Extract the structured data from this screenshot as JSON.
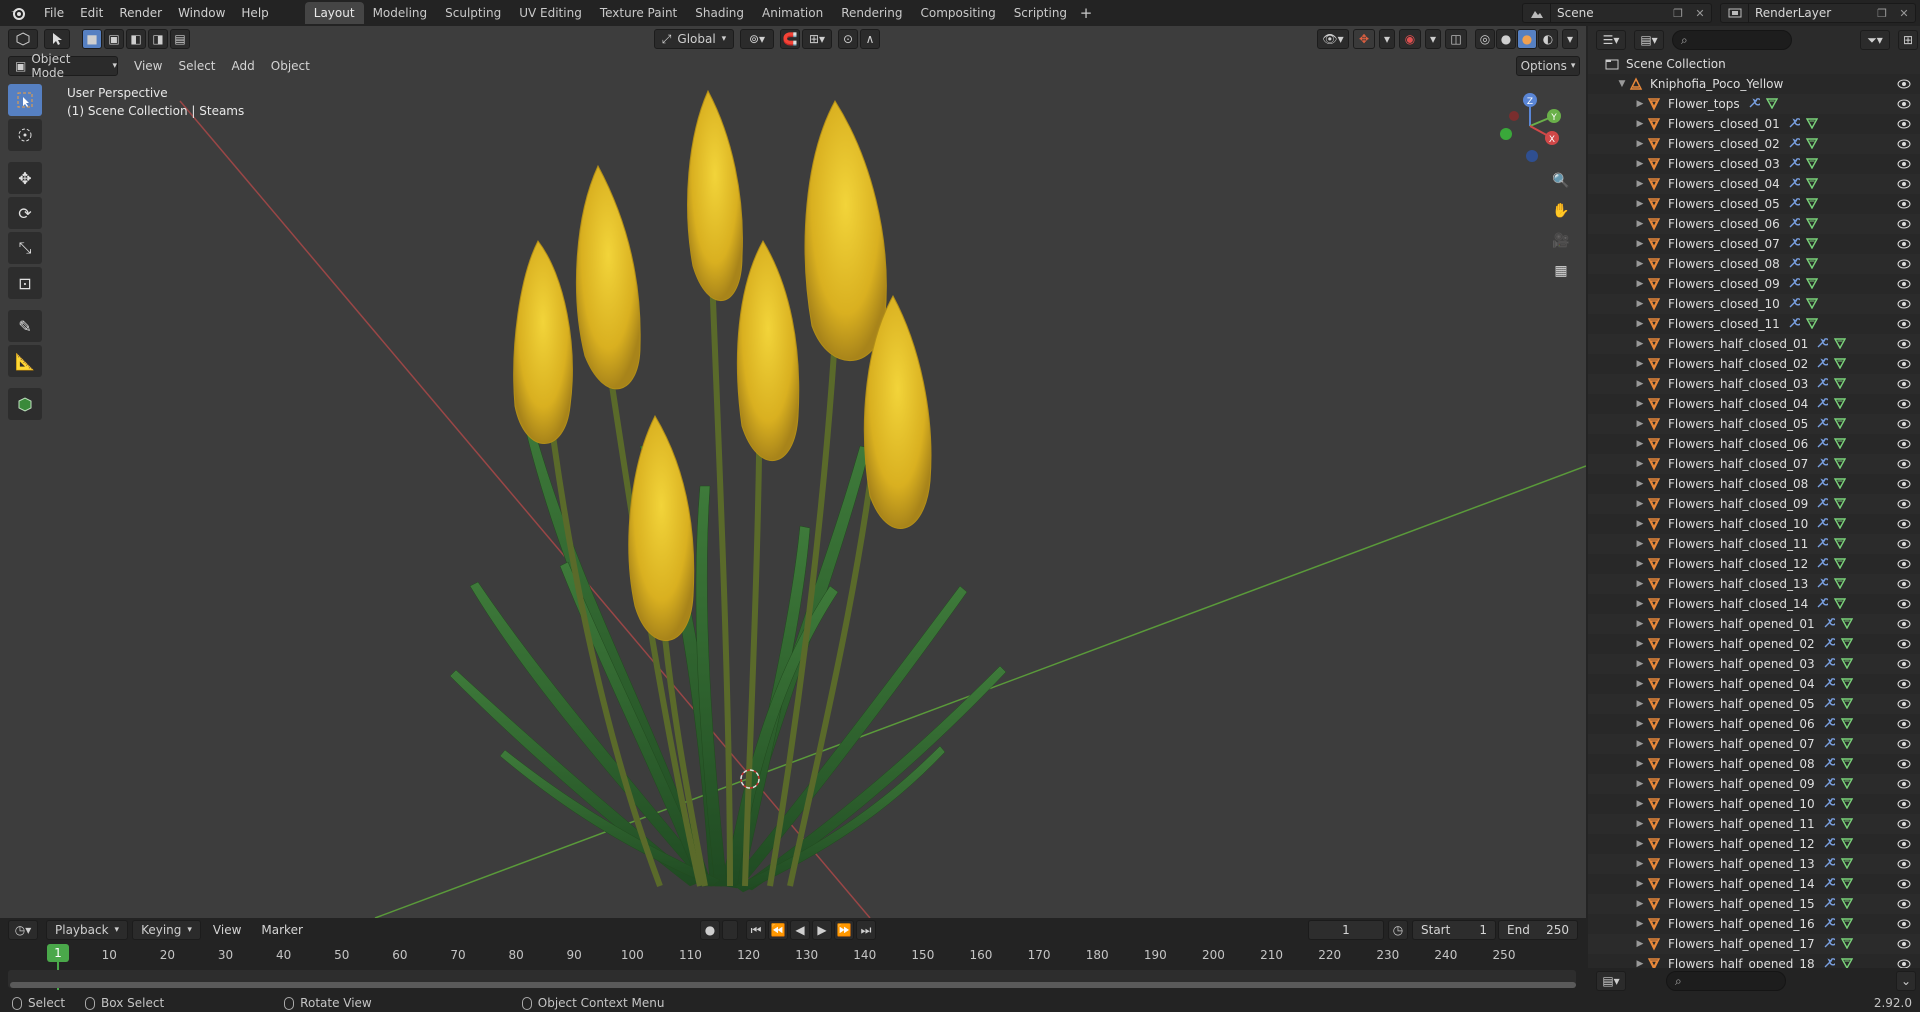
{
  "topbar": {
    "menus": [
      "File",
      "Edit",
      "Render",
      "Window",
      "Help"
    ],
    "workspaces": [
      "Layout",
      "Modeling",
      "Sculpting",
      "UV Editing",
      "Texture Paint",
      "Shading",
      "Animation",
      "Rendering",
      "Compositing",
      "Scripting"
    ],
    "active_workspace": "Layout",
    "add_tab": "+",
    "scene": "Scene",
    "view_layer": "RenderLayer"
  },
  "viewport": {
    "mode": "Object Mode",
    "menus": [
      "View",
      "Select",
      "Add",
      "Object"
    ],
    "transform_orientation": "Global",
    "options_label": "Options",
    "info_line1": "User Perspective",
    "info_line2": "(1) Scene Collection | Steams",
    "gizmo_axes": [
      "Z",
      "Y",
      "X"
    ]
  },
  "timeline": {
    "menus": [
      "Playback",
      "Keying",
      "View",
      "Marker"
    ],
    "current_frame": "1",
    "start_label": "Start",
    "start_value": "1",
    "end_label": "End",
    "end_value": "250",
    "ruler_ticks": [
      "10",
      "20",
      "30",
      "40",
      "50",
      "60",
      "70",
      "80",
      "90",
      "100",
      "110",
      "120",
      "130",
      "140",
      "150",
      "160",
      "170",
      "180",
      "190",
      "200",
      "210",
      "220",
      "230",
      "240",
      "250"
    ],
    "frame_marker": "1"
  },
  "statusbar": {
    "select": "Select",
    "box_select": "Box Select",
    "rotate_view": "Rotate View",
    "context_menu": "Object Context Menu",
    "version": "2.92.0"
  },
  "outliner": {
    "scene_collection": "Scene Collection",
    "root_object": "Kniphofia_Poco_Yellow",
    "items": [
      "Flower_tops",
      "Flowers_closed_01",
      "Flowers_closed_02",
      "Flowers_closed_03",
      "Flowers_closed_04",
      "Flowers_closed_05",
      "Flowers_closed_06",
      "Flowers_closed_07",
      "Flowers_closed_08",
      "Flowers_closed_09",
      "Flowers_closed_10",
      "Flowers_closed_11",
      "Flowers_half_closed_01",
      "Flowers_half_closed_02",
      "Flowers_half_closed_03",
      "Flowers_half_closed_04",
      "Flowers_half_closed_05",
      "Flowers_half_closed_06",
      "Flowers_half_closed_07",
      "Flowers_half_closed_08",
      "Flowers_half_closed_09",
      "Flowers_half_closed_10",
      "Flowers_half_closed_11",
      "Flowers_half_closed_12",
      "Flowers_half_closed_13",
      "Flowers_half_closed_14",
      "Flowers_half_opened_01",
      "Flowers_half_opened_02",
      "Flowers_half_opened_03",
      "Flowers_half_opened_04",
      "Flowers_half_opened_05",
      "Flowers_half_opened_06",
      "Flowers_half_opened_07",
      "Flowers_half_opened_08",
      "Flowers_half_opened_09",
      "Flowers_half_opened_10",
      "Flowers_half_opened_11",
      "Flowers_half_opened_12",
      "Flowers_half_opened_13",
      "Flowers_half_opened_14",
      "Flowers_half_opened_15",
      "Flowers_half_opened_16",
      "Flowers_half_opened_17",
      "Flowers_half_opened_18"
    ]
  },
  "colors": {
    "accent_blue": "#5680c2",
    "frame_green": "#4aa84a",
    "object_orange": "#e8883a",
    "modifier_blue": "#7aa0e0",
    "mesh_green": "#7bd47b"
  }
}
